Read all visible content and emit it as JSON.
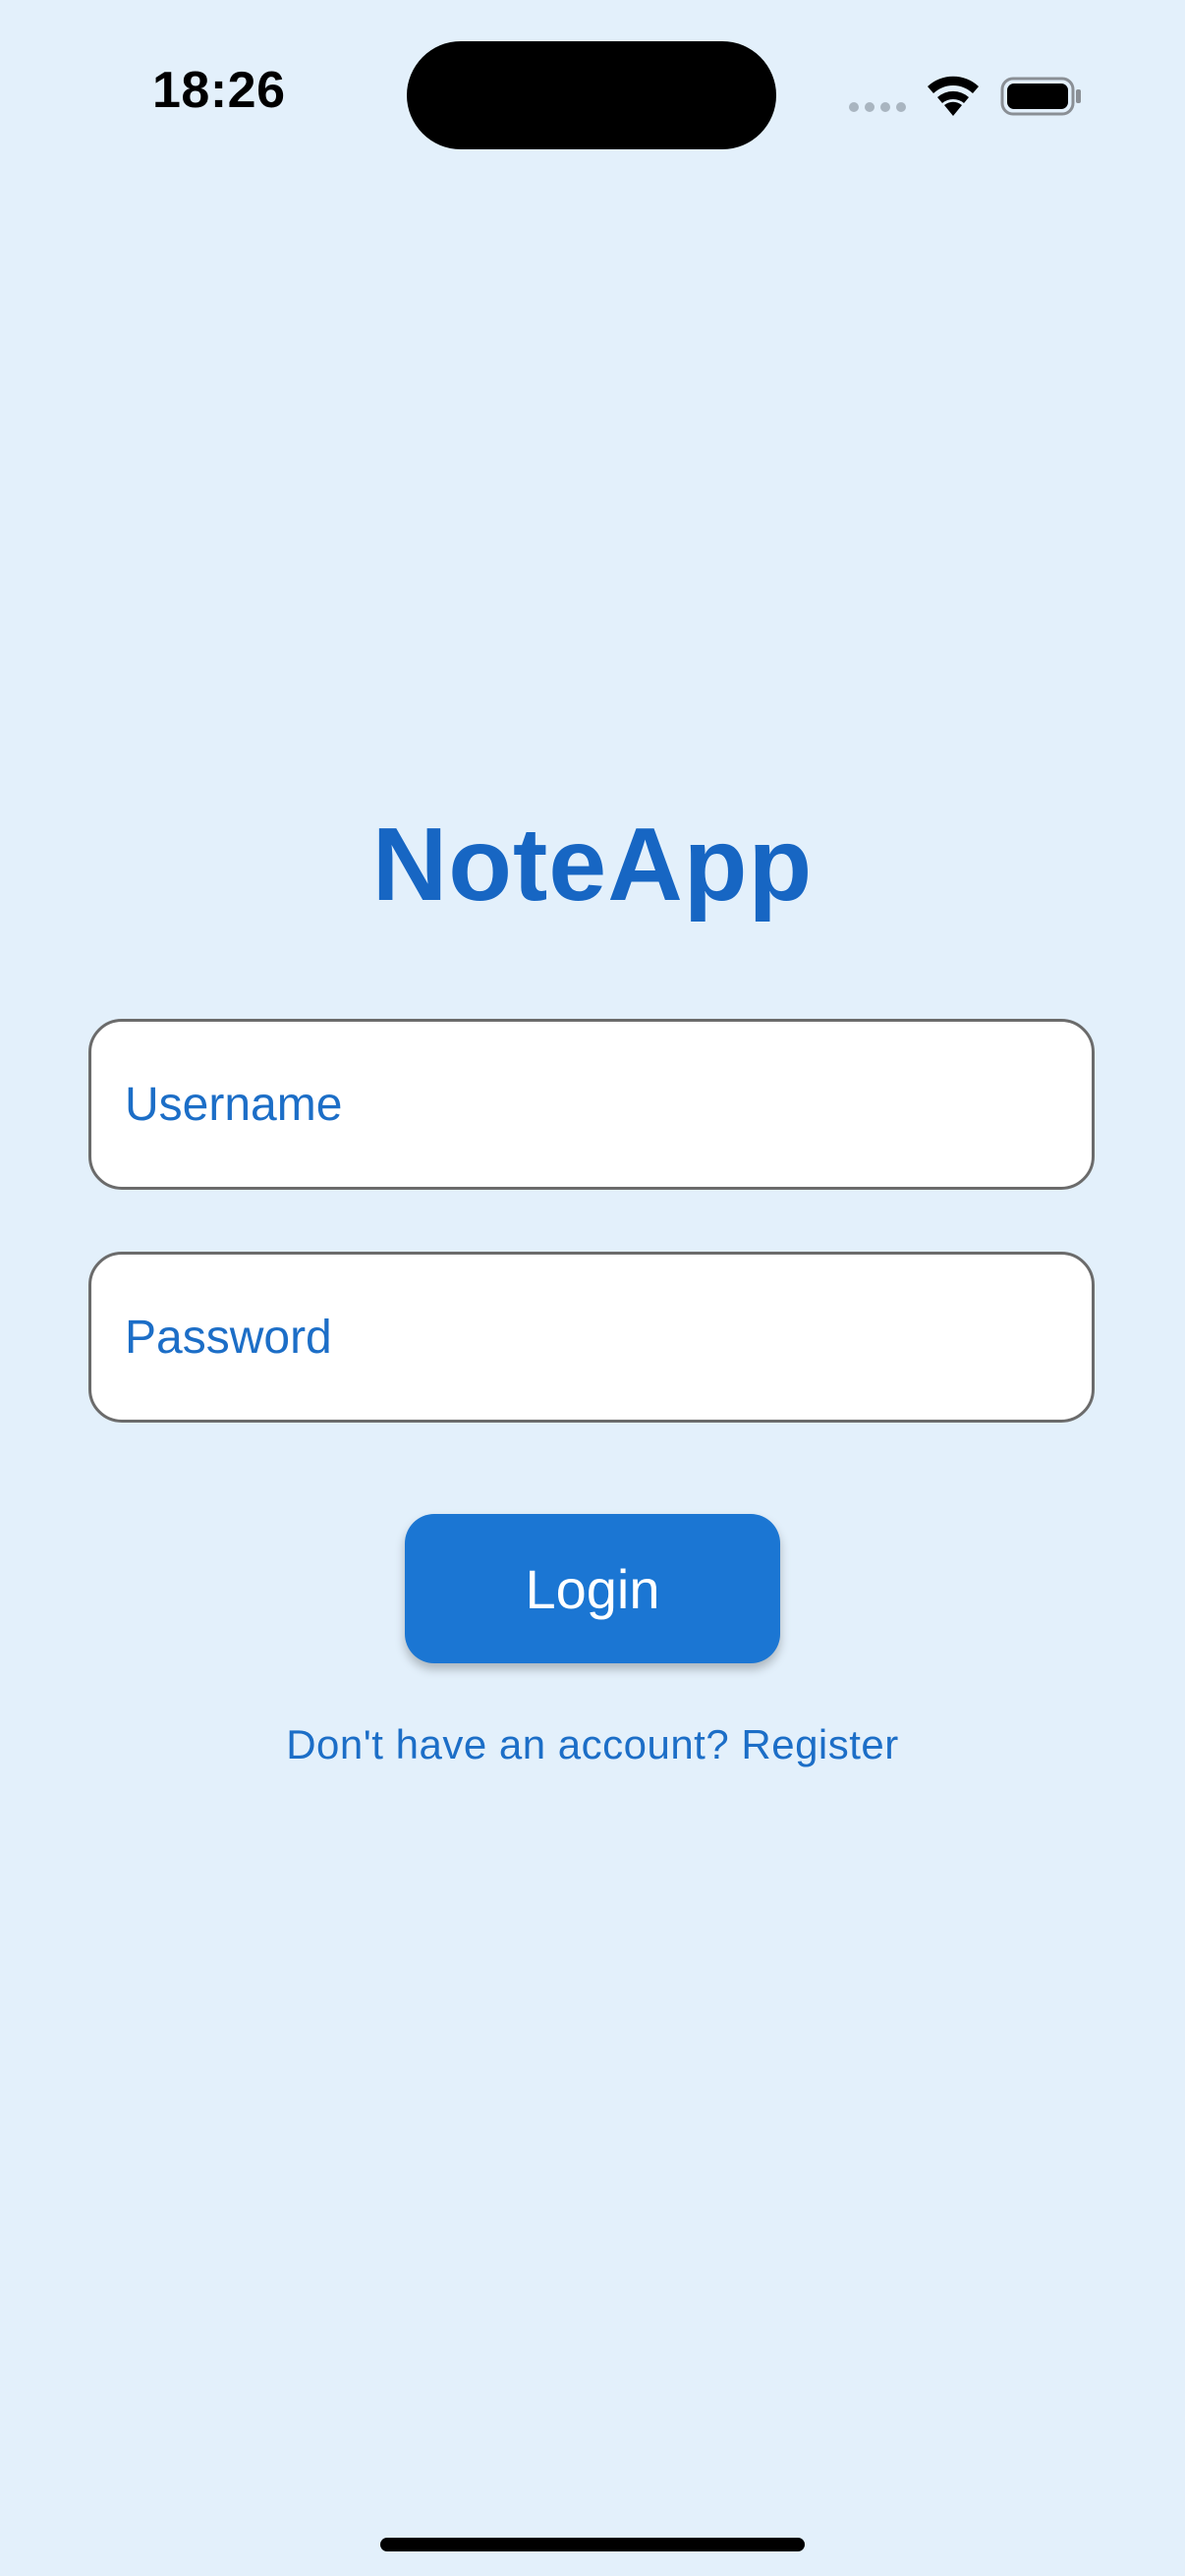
{
  "status_bar": {
    "time": "18:26",
    "icons": [
      "signal-icon",
      "wifi-icon",
      "battery-icon"
    ]
  },
  "app": {
    "title": "NoteApp",
    "username": {
      "placeholder": "Username",
      "value": ""
    },
    "password": {
      "placeholder": "Password",
      "value": ""
    },
    "login_label": "Login",
    "register_prompt": "Don't have an account? Register"
  },
  "colors": {
    "background": "#e3f0fb",
    "accent": "#1b76d3",
    "title": "#1766c3",
    "field_border": "#6b6b6b"
  }
}
